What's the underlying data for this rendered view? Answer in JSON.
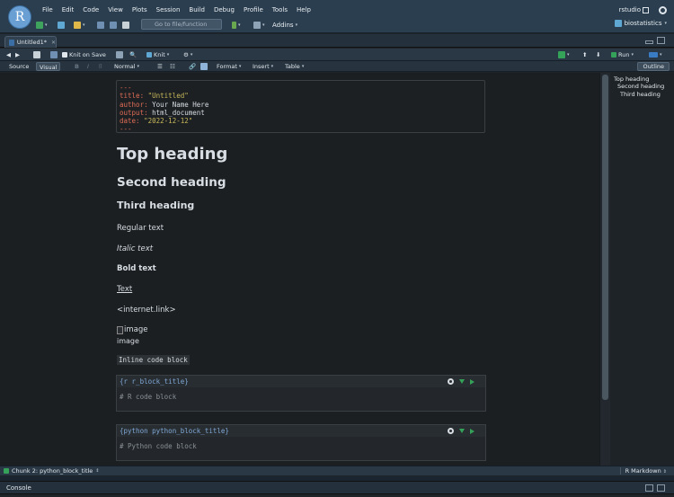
{
  "menu": [
    "File",
    "Edit",
    "Code",
    "View",
    "Plots",
    "Session",
    "Build",
    "Debug",
    "Profile",
    "Tools",
    "Help"
  ],
  "app_user": "rstudio",
  "logo_letter": "R",
  "goto_placeholder": "Go to file/function",
  "addins_label": "Addins",
  "project_name": "biostatistics",
  "file_tab": "Untitled1*",
  "toolbar": {
    "knit_on_save": "Knit on Save",
    "knit": "Knit",
    "run": "Run"
  },
  "mode": {
    "source": "Source",
    "visual": "Visual",
    "format_normal": "Normal",
    "format": "Format",
    "insert": "Insert",
    "table": "Table",
    "outline": "Outline"
  },
  "yaml": {
    "open": "---",
    "title_key": "title: ",
    "title_val": "\"Untitled\"",
    "author_key": "author: ",
    "author_val": "Your Name Here",
    "output_key": "output: ",
    "output_val": "html_document",
    "date_key": "date: ",
    "date_val": "\"2022-12-12\"",
    "close": "---"
  },
  "doc": {
    "h1": "Top heading",
    "h2": "Second heading",
    "h3": "Third heading",
    "regular": "Regular text",
    "italic": "Italic text",
    "bold": "Bold text",
    "link": "Text",
    "autolink": "<internet.link>",
    "image_alt": "image",
    "image_caption": "image",
    "inline_code": "Inline code block"
  },
  "chunks": [
    {
      "header": "{r r_block_title}",
      "body": "# R code block"
    },
    {
      "header": "{python python_block_title}",
      "body": "# Python code block"
    }
  ],
  "outline_items": [
    "Top heading",
    "Second heading",
    "Third heading"
  ],
  "status": {
    "chunk": "Chunk 2: python_block_title",
    "doc_type": "R Markdown"
  },
  "console_label": "Console",
  "colors": {
    "accent_green": "#35a25a",
    "yaml_key": "#e06c55",
    "yaml_string": "#c9b85a",
    "chunk_header": "#7fa8d6"
  }
}
